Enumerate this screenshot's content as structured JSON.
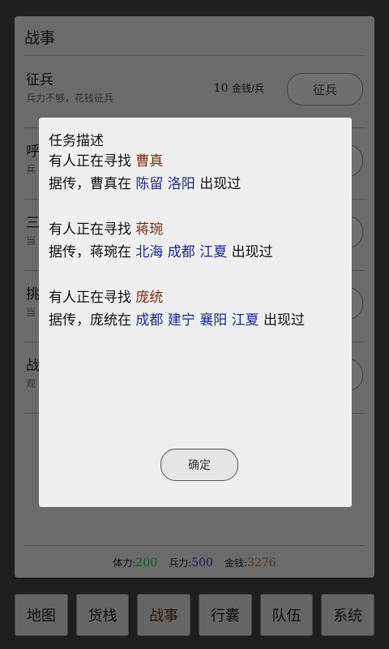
{
  "panel": {
    "title": "战事"
  },
  "rows": [
    {
      "title": "征兵",
      "sub": "兵力不够，花钱征兵",
      "cost": "10",
      "cost_unit": "金钱/兵",
      "button": "征兵"
    },
    {
      "title": "呼",
      "sub": "兵"
    },
    {
      "title": "三",
      "sub": "当"
    },
    {
      "title": "挑",
      "sub": "当"
    },
    {
      "title": "战",
      "sub": "观"
    }
  ],
  "status": {
    "stamina_label": "体力:",
    "stamina_value": "200",
    "troops_label": "兵力:",
    "troops_value": "500",
    "gold_label": "金钱:",
    "gold_value": "3276"
  },
  "nav": [
    "地图",
    "货栈",
    "战事",
    "行囊",
    "队伍",
    "系统"
  ],
  "dialog": {
    "title": "任务描述",
    "tasks": [
      {
        "seek": "有人正在寻找",
        "name": "曹真",
        "rumor_prefix": "据传，",
        "rumor_name": "曹真",
        "rumor_at": "在",
        "locations": "陈留 洛阳",
        "appeared": "出现过"
      },
      {
        "seek": "有人正在寻找",
        "name": "蒋琬",
        "rumor_prefix": "据传，",
        "rumor_name": "蒋琬",
        "rumor_at": "在",
        "locations": "北海 成都 江夏",
        "appeared": "出现过"
      },
      {
        "seek": "有人正在寻找",
        "name": "庞统",
        "rumor_prefix": "据传，",
        "rumor_name": "庞统",
        "rumor_at": "在",
        "locations": "成都 建宁 襄阳 江夏",
        "appeared": "出现过"
      }
    ],
    "confirm": "确定"
  }
}
